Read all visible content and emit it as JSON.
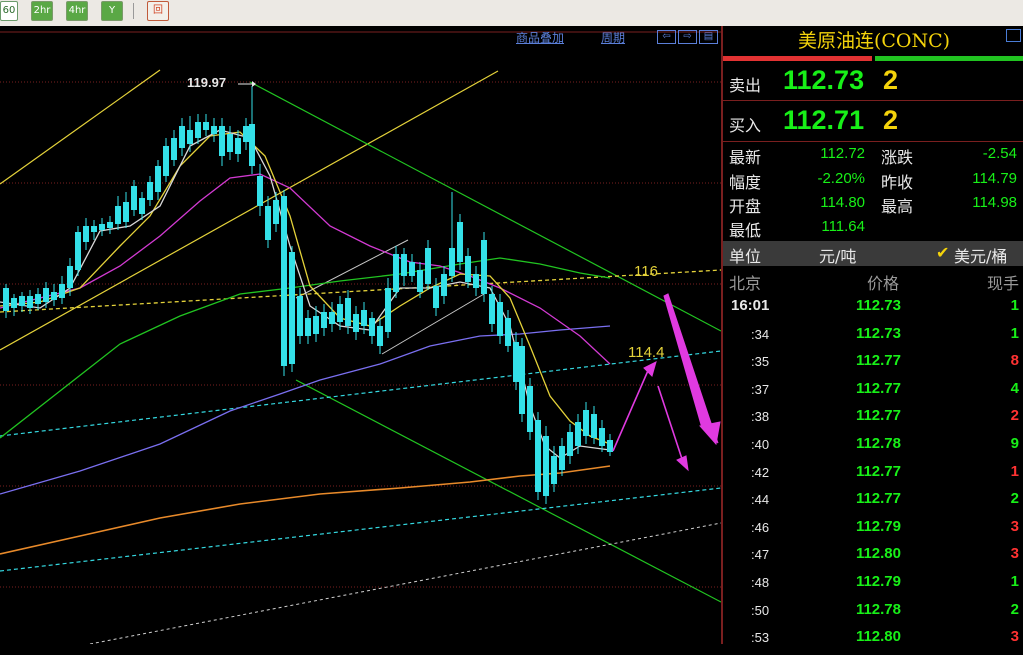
{
  "toolbar": {
    "buttons": [
      "60",
      "2hr",
      "4hr",
      "Y",
      "回"
    ]
  },
  "chart": {
    "links": {
      "overlay": "商品叠加",
      "period": "周期"
    },
    "annotations": {
      "high": "119.97",
      "level_116": "116",
      "level_114_4": "114.4"
    },
    "colors": {
      "up": "#000000",
      "down": "#34e0e8",
      "bg": "#000000"
    }
  },
  "quote": {
    "title": "美原油连(CONC)",
    "sell": {
      "label": "卖出",
      "price": "112.73",
      "volume": "2"
    },
    "buy": {
      "label": "买入",
      "price": "112.71",
      "volume": "2"
    },
    "stats": [
      {
        "label": "最新",
        "value": "112.72",
        "label2": "涨跌",
        "value2": "-2.54"
      },
      {
        "label": "幅度",
        "value": "-2.20%",
        "label2": "昨收",
        "value2": "114.79"
      },
      {
        "label": "开盘",
        "value": "114.80",
        "label2": "最高",
        "value2": "114.98"
      },
      {
        "label": "最低",
        "value": "111.64",
        "label2": "",
        "value2": ""
      }
    ],
    "unit": {
      "label": "单位",
      "value": "元/吨",
      "checked": "美元/桶"
    },
    "headers": {
      "time": "北京",
      "price": "价格",
      "volume": "现手"
    },
    "trades": [
      {
        "time": "16:01",
        "price": "112.73",
        "volume": "1",
        "color": "#18f018"
      },
      {
        "time": ":34",
        "price": "112.73",
        "volume": "1",
        "color": "#18f018"
      },
      {
        "time": ":35",
        "price": "112.77",
        "volume": "8",
        "color": "#ff3232"
      },
      {
        "time": ":37",
        "price": "112.77",
        "volume": "4",
        "color": "#18f018"
      },
      {
        "time": ":38",
        "price": "112.77",
        "volume": "2",
        "color": "#ff3232"
      },
      {
        "time": ":40",
        "price": "112.78",
        "volume": "9",
        "color": "#18f018"
      },
      {
        "time": ":42",
        "price": "112.77",
        "volume": "1",
        "color": "#ff3232"
      },
      {
        "time": ":44",
        "price": "112.77",
        "volume": "2",
        "color": "#18f018"
      },
      {
        "time": ":46",
        "price": "112.79",
        "volume": "3",
        "color": "#ff3232"
      },
      {
        "time": ":47",
        "price": "112.80",
        "volume": "3",
        "color": "#ff3232"
      },
      {
        "time": ":48",
        "price": "112.79",
        "volume": "1",
        "color": "#18f018"
      },
      {
        "time": ":50",
        "price": "112.78",
        "volume": "2",
        "color": "#18f018"
      },
      {
        "time": ":53",
        "price": "112.80",
        "volume": "3",
        "color": "#ff3232"
      }
    ]
  }
}
